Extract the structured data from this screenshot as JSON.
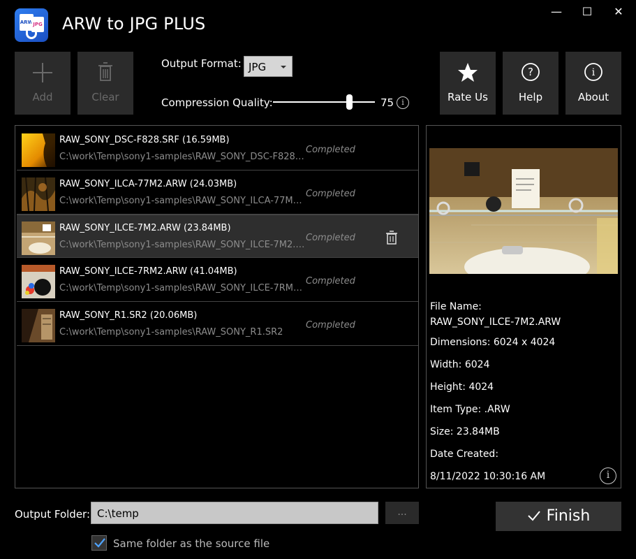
{
  "window": {
    "title": "ARW to JPG PLUS",
    "icon_text_1": "ARW",
    "icon_text_2": "JPG",
    "minimize_glyph": "—",
    "maximize_glyph": "☐",
    "close_glyph": "✕"
  },
  "toolbar": {
    "add_label": "Add",
    "clear_label": "Clear",
    "rate_label": "Rate Us",
    "help_label": "Help",
    "about_label": "About",
    "output_format_label": "Output Format:",
    "output_format_value": "JPG",
    "compression_label": "Compression Quality:",
    "compression_value": "75",
    "compression_fraction": 0.75
  },
  "files": [
    {
      "name": "RAW_SONY_DSC-F828.SRF (16.59MB)",
      "path": "C:\\work\\Temp\\sony1-samples\\RAW_SONY_DSC-F828.SRF",
      "status": "Completed"
    },
    {
      "name": "RAW_SONY_ILCA-77M2.ARW (24.03MB)",
      "path": "C:\\work\\Temp\\sony1-samples\\RAW_SONY_ILCA-77M2....",
      "status": "Completed"
    },
    {
      "name": "RAW_SONY_ILCE-7M2.ARW (23.84MB)",
      "path": "C:\\work\\Temp\\sony1-samples\\RAW_SONY_ILCE-7M2.A...",
      "status": "Completed"
    },
    {
      "name": "RAW_SONY_ILCE-7RM2.ARW (41.04MB)",
      "path": "C:\\work\\Temp\\sony1-samples\\RAW_SONY_ILCE-7RM2....",
      "status": "Completed"
    },
    {
      "name": "RAW_SONY_R1.SR2 (20.06MB)",
      "path": "C:\\work\\Temp\\sony1-samples\\RAW_SONY_R1.SR2",
      "status": "Completed"
    }
  ],
  "details": {
    "file_name_label": "File Name:",
    "file_name_value": "RAW_SONY_ILCE-7M2.ARW",
    "dimensions": "Dimensions: 6024 x 4024",
    "width": "Width: 6024",
    "height": "Height: 4024",
    "item_type": "Item Type: .ARW",
    "size": "Size: 23.84MB",
    "date_created_label": "Date Created:",
    "date_created_value": "8/11/2022 10:30:16 AM"
  },
  "bottom": {
    "output_folder_label": "Output Folder:",
    "output_folder_value": "C:\\temp",
    "browse_label": "...",
    "finish_label": "Finish",
    "same_folder_label": "Same folder as the source file",
    "same_folder_checked": true
  },
  "colors": {
    "background": "#000000",
    "button_bg": "#2a2a2a",
    "selected_row": "#2e2e2e",
    "muted_text": "#8c8c8c",
    "checkbox_accent": "#4ea3ff"
  }
}
